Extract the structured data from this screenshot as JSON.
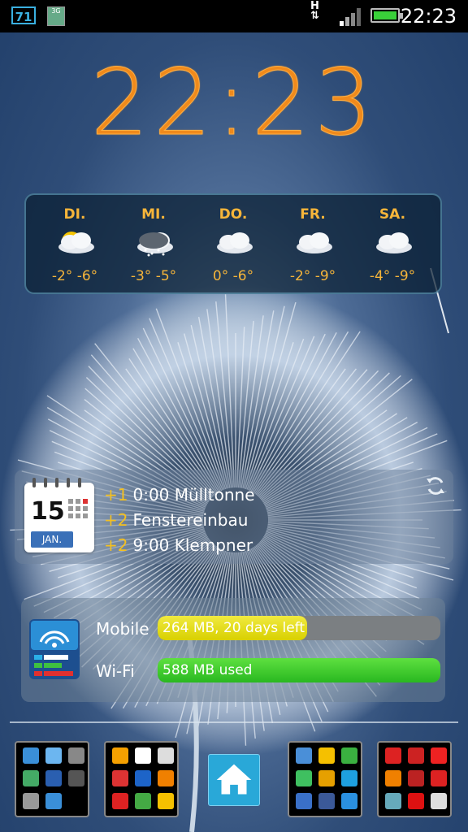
{
  "status_bar": {
    "notification_count": "71",
    "network_type": "H",
    "time": "22:23",
    "battery_level": 1.0,
    "accent": "#3ab0e0"
  },
  "clock": {
    "time": "22:23",
    "color": "#f08a1c"
  },
  "weather": {
    "days": [
      {
        "name": "DI.",
        "icon": "partly-sunny-icon",
        "temps": "-2° -6°"
      },
      {
        "name": "MI.",
        "icon": "snow-cloud-icon",
        "temps": "-3° -5°"
      },
      {
        "name": "DO.",
        "icon": "cloud-icon",
        "temps": "0° -6°"
      },
      {
        "name": "FR.",
        "icon": "cloud-icon",
        "temps": "-2° -9°"
      },
      {
        "name": "SA.",
        "icon": "cloud-icon",
        "temps": "-4° -9°"
      }
    ]
  },
  "calendar": {
    "icon_day": "15",
    "icon_month": "JAN.",
    "events": [
      {
        "offset": "+1",
        "text": "0:00 Mülltonne"
      },
      {
        "offset": "+2",
        "text": "Fenstereinbau"
      },
      {
        "offset": "+2",
        "text": "9:00 Klempner"
      }
    ]
  },
  "data_usage": {
    "mobile": {
      "label": "Mobile",
      "text": "264 MB, 20 days left",
      "fill": 0.53,
      "color": "#d8d000"
    },
    "wifi": {
      "label": "Wi-Fi",
      "text": "588 MB used",
      "fill": 1.0,
      "color": "#29b820"
    }
  },
  "dock": {
    "folders": [
      {
        "name": "tools-folder",
        "icons": [
          "media-icon",
          "apps-icon",
          "android-icon",
          "settings-icon",
          "gps-icon",
          "battery-icon",
          "calc-icon",
          "camera-icon"
        ]
      },
      {
        "name": "shopping-folder",
        "icons": [
          "amazon-icon",
          "ebay-icon",
          "play-store-icon",
          "cart-icon",
          "sparkasse-icon",
          "navigation-icon",
          "db-icon",
          "tram-icon",
          "dict-icon"
        ]
      },
      {
        "name": "communication-folder",
        "icons": [
          "mail-icon",
          "email-icon",
          "phone-icon",
          "whatsapp-icon",
          "talk-icon",
          "skype-icon",
          "browser-icon",
          "facebook-icon",
          "globe-icon"
        ]
      },
      {
        "name": "news-folder",
        "icons": [
          "news-icon",
          "tv-icon",
          "bild-icon",
          "rss-icon",
          "video-icon",
          "music-icon",
          "gallery-icon",
          "youtube-icon",
          "tv-guide-icon"
        ]
      }
    ],
    "home": "home-icon"
  }
}
